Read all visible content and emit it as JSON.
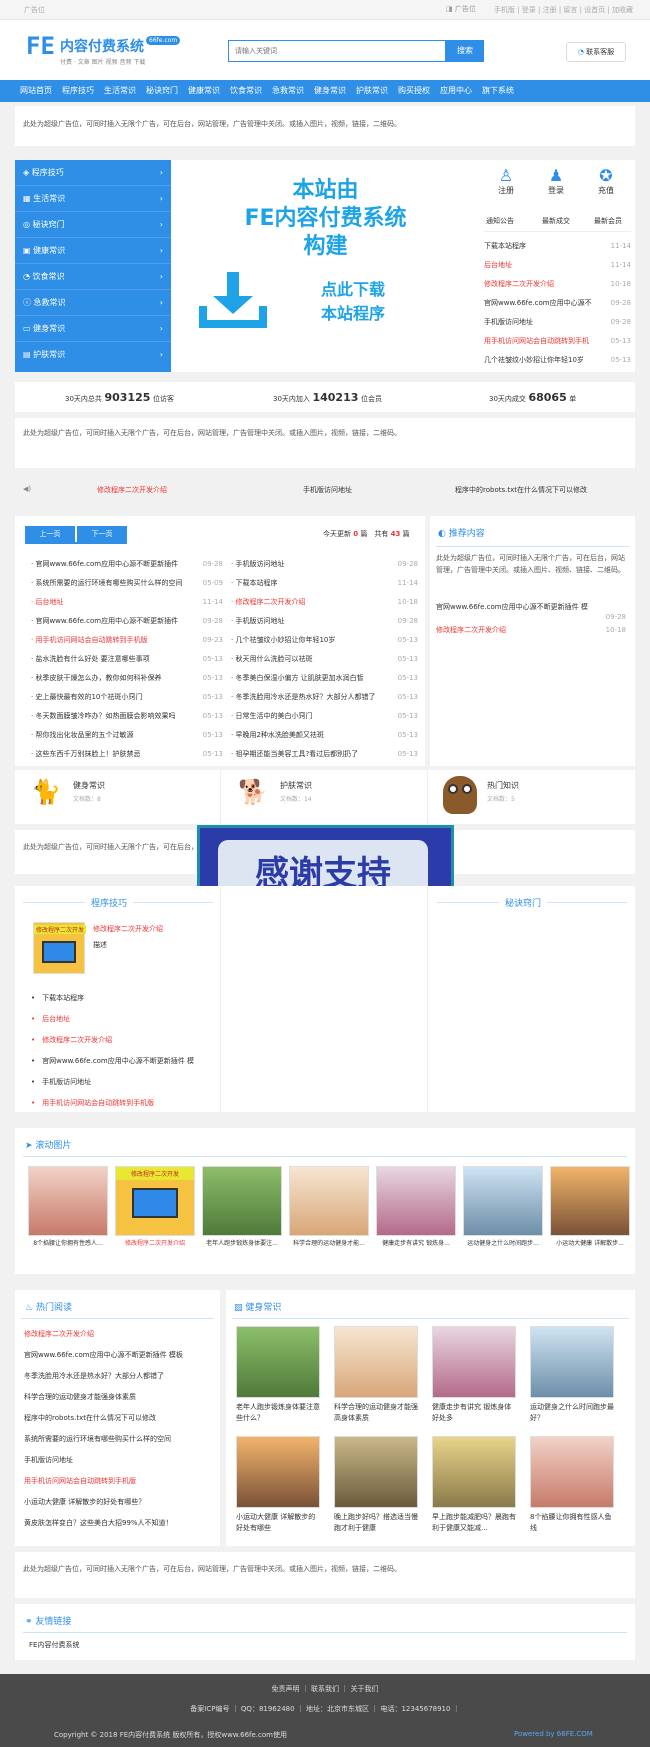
{
  "topbar": {
    "ad": "广告位",
    "ad_right": "广告位",
    "links": "手机版 | 登录 | 注册 | 留言 | 设首页 | 加收藏"
  },
  "header": {
    "logo_fe": "FE",
    "logo_name": "内容付费系统",
    "logo_badge": "66fe.com",
    "logo_sub": "付费 · 文章 图片 视频 音频 下载",
    "search_placeholder": "请输入关键词",
    "search_button": "搜索",
    "contact": "联系客服"
  },
  "nav": [
    "网站首页",
    "程序技巧",
    "生活常识",
    "秘诀窍门",
    "健康常识",
    "饮食常识",
    "急救常识",
    "健身常识",
    "护肤常识",
    "购买授权",
    "应用中心",
    "旗下系统"
  ],
  "ad_text": "此处为超级广告位，可同时插入无限个广告，可在后台，网站管理，广告管理中关闭。或插入图片，视频，链接，二维码。",
  "sidebar": [
    "程序技巧",
    "生活常识",
    "秘诀窍门",
    "健康常识",
    "饮食常识",
    "急救常识",
    "健身常识",
    "护肤常识"
  ],
  "banner": {
    "line1": "本站由",
    "line2": "FE内容付费系统",
    "line3": "构建",
    "line4": "点此下载",
    "line5": "本站程序"
  },
  "user_panel": {
    "register": "注册",
    "login": "登录",
    "recharge": "充值",
    "tabs": [
      "通知公告",
      "最新成交",
      "最新会员"
    ],
    "items": [
      {
        "t": "下载本站程序",
        "d": "11-14",
        "red": false
      },
      {
        "t": "后台地址",
        "d": "11-14",
        "red": true
      },
      {
        "t": "修改程序二次开发介绍",
        "d": "10-18",
        "red": true
      },
      {
        "t": "官网www.66fe.com应用中心源不",
        "d": "09-28",
        "red": false
      },
      {
        "t": "手机版访问地址",
        "d": "09-28",
        "red": false
      },
      {
        "t": "用手机访问网站会自动跳转到手机",
        "d": "05-13",
        "red": true
      },
      {
        "t": "几个祛皱纹小妙招让你年轻10岁",
        "d": "05-13",
        "red": false
      }
    ]
  },
  "stats": [
    {
      "label": "30天内总共",
      "value": "903125",
      "unit": "位访客"
    },
    {
      "label": "30天内加入",
      "value": "140213",
      "unit": "位会员"
    },
    {
      "label": "30天内成交",
      "value": "68065",
      "unit": "单"
    }
  ],
  "notice": [
    "修改程序二次开发介绍",
    "手机版访问地址",
    "程序中的robots.txt在什么情况下可以修改"
  ],
  "updates": {
    "prev": "上一页",
    "next": "下一页",
    "today": "今天更新",
    "today_n": "0",
    "unit": "篇",
    "total": "共有",
    "total_n": "43",
    "left": [
      {
        "t": "官网www.66fe.com应用中心源不断更新插件",
        "d": "09-28",
        "red": false
      },
      {
        "t": "系统所需要的运行环境有哪些购买什么样的空间",
        "d": "05-09",
        "red": false
      },
      {
        "t": "后台地址",
        "d": "11-14",
        "red": true
      },
      {
        "t": "官网www.66fe.com应用中心源不断更新插件",
        "d": "09-28",
        "red": false
      },
      {
        "t": "用手机访问网站会自动跳转到手机版",
        "d": "09-23",
        "red": true
      },
      {
        "t": "盐水洗脸有什么好处 要注意哪些事项",
        "d": "05-13",
        "red": false
      },
      {
        "t": "秋季皮肤干燥怎么办，教你如何科补保养",
        "d": "05-13",
        "red": false
      },
      {
        "t": "史上最快最有效的10个祛斑小窍门",
        "d": "05-13",
        "red": false
      },
      {
        "t": "冬天数面膜皱冷咋办？如热面膜会影响效果吗",
        "d": "05-13",
        "red": false
      },
      {
        "t": "帮你找出化妆品里的五个过敏源",
        "d": "05-13",
        "red": false
      },
      {
        "t": "这些东西千万别抹脸上！护肤禁忌",
        "d": "05-13",
        "red": false
      }
    ],
    "right": [
      {
        "t": "手机版访问地址",
        "d": "09-28",
        "red": false
      },
      {
        "t": "下载本站程序",
        "d": "11-14",
        "red": false
      },
      {
        "t": "修改程序二次开发介绍",
        "d": "10-18",
        "red": true
      },
      {
        "t": "手机版访问地址",
        "d": "09-28",
        "red": false
      },
      {
        "t": "几个祛皱纹小妙招让你年轻10岁",
        "d": "05-13",
        "red": false
      },
      {
        "t": "秋天用什么洗脸可以祛斑",
        "d": "05-13",
        "red": false
      },
      {
        "t": "冬季美白保湿小偏方 让肌肤更加水润白皙",
        "d": "05-13",
        "red": false
      },
      {
        "t": "冬季洗脸用冷水还是热水好？大部分人都错了",
        "d": "05-13",
        "red": false
      },
      {
        "t": "日常生活中的美白小窍门",
        "d": "05-13",
        "red": false
      },
      {
        "t": "早晚用2种水洗脸美颜又祛斑",
        "d": "05-13",
        "red": false
      },
      {
        "t": "祖孕期还能当美容工具?看过后都别扔了",
        "d": "05-13",
        "red": false
      }
    ]
  },
  "recommend": {
    "title": "推荐内容",
    "text": "此处为超级广告位，可同时插入无限个广告，可在后台，网站管理，广告管理中关闭。或插入图片、视频、链接、二维码。",
    "items": [
      {
        "t": "官网www.66fe.com应用中心源不断更新插件 模",
        "d": "09-28",
        "red": false
      },
      {
        "t": "修改程序二次开发介绍",
        "d": "10-18",
        "red": true
      }
    ]
  },
  "cats3": [
    {
      "title": "健身常识",
      "sub": "文档数：8"
    },
    {
      "title": "护肤常识",
      "sub": "文档数：14"
    },
    {
      "title": "热门知识",
      "sub": "文档数：5"
    }
  ],
  "thanks": "感谢支持",
  "cols": {
    "left_title": "程序技巧",
    "right_title": "秘诀窍门",
    "feat_title": "修改程序二次开发介绍",
    "feat_desc": "描述",
    "feat_img": "修改程序二次开发",
    "list": [
      {
        "t": "下载本站程序",
        "red": false
      },
      {
        "t": "后台地址",
        "red": true
      },
      {
        "t": "修改程序二次开发介绍",
        "red": true
      },
      {
        "t": "官网www.66fe.com应用中心源不断更新插件 模",
        "red": false
      },
      {
        "t": "手机版访问地址",
        "red": false
      },
      {
        "t": "用手机访问网站会自动跳转到手机版",
        "red": true
      }
    ]
  },
  "scroll": {
    "title": "滚动图片",
    "items": [
      "8个掐腰让你拥有性感人...",
      "修改程序二次开发介绍",
      "老年人跑步锻炼身体要注...",
      "科学合理的运动健身才能...",
      "健康走步有讲究 锻炼身...",
      "运动健身之什么时间跑步...",
      "小运动大健康 详解散步..."
    ],
    "badge": "修改程序二次开发"
  },
  "hot": {
    "title": "热门阅读",
    "items": [
      {
        "t": "修改程序二次开发介绍",
        "red": true
      },
      {
        "t": "官网www.66fe.com应用中心源不断更新插件 模板",
        "red": false
      },
      {
        "t": "冬季洗脸用冷水还是热水好？大部分人都错了",
        "red": false
      },
      {
        "t": "科学合理的运动健身才能强身体素质",
        "red": false
      },
      {
        "t": "程序中的robots.txt在什么情况下可以修改",
        "red": false
      },
      {
        "t": "系统所需要的运行环境有哪些购买什么样的空间",
        "red": false
      },
      {
        "t": "手机版访问地址",
        "red": false
      },
      {
        "t": "用手机访问网站会自动跳转到手机版",
        "red": true
      },
      {
        "t": "小运动大健康 详解散步的好处有哪些？",
        "red": false
      },
      {
        "t": "黄皮肤怎样变白？这些美白大招99%人不知道！",
        "red": false
      }
    ]
  },
  "fitness": {
    "title": "健身常识",
    "items": [
      "老年人跑步锻炼身体要注意些什么？",
      "科学合理的运动健身才能强高身体素质",
      "健康走步有讲究 锻炼身体好处多",
      "运动健身之什么时间跑步最好？",
      "小运动大健康 详解散步的好处有哪些",
      "晚上跑步好吗？搭选适当慢跑才利于健康",
      "早上跑步能减肥吗？晨跑有利于健康又能减...",
      "8个掐腰让你拥有性感人鱼线"
    ]
  },
  "links": {
    "title": "友情链接",
    "items": [
      "FE内容付费系统"
    ]
  },
  "footer": {
    "links": [
      "免责声明",
      "联系我们",
      "关于我们"
    ],
    "icp": "备案ICP编号 ｜ QQ：81962480 ｜ 地址：北京市东城区 ｜ 电话：12345678910 ｜",
    "copy": "Copyright © 2018 FE内容付费系统 版权所有，授权www.66fe.com使用",
    "powered": "Powered by 66FE.COM"
  },
  "colors": {
    "primary": "#2f8fe6",
    "red": "#e33",
    "banner_blue": "#1ea3e6"
  }
}
